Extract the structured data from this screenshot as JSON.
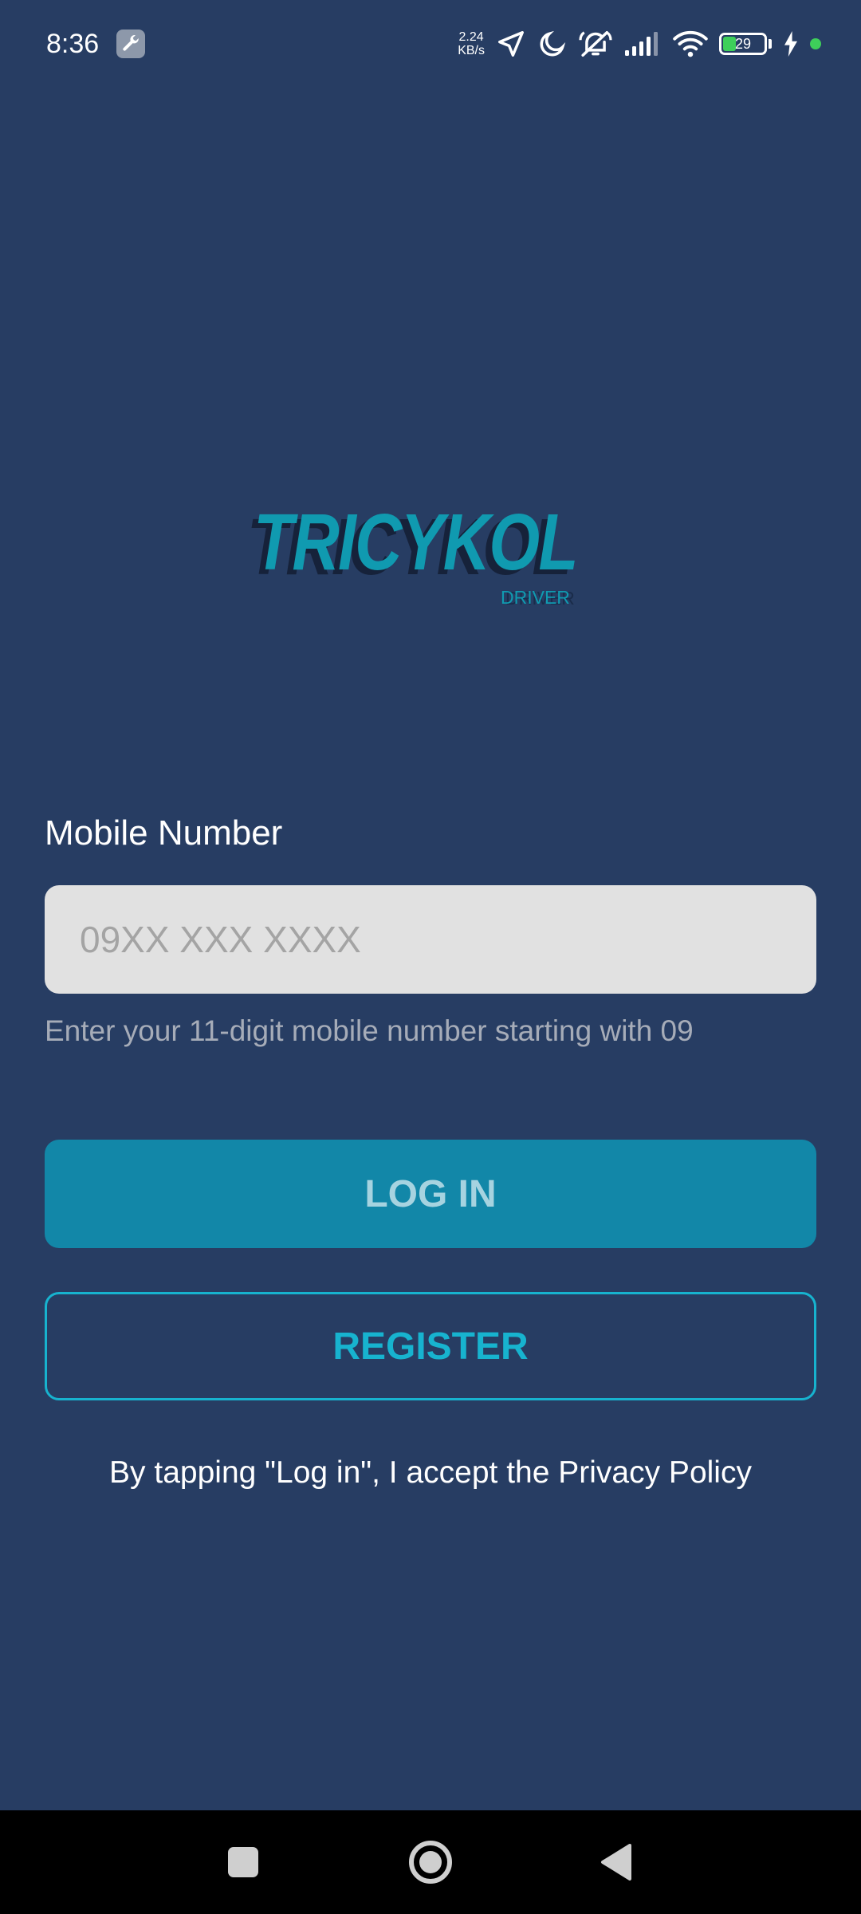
{
  "status_bar": {
    "time": "8:36",
    "net_speed_value": "2.24",
    "net_speed_unit": "KB/s",
    "battery_level": "29",
    "battery_fraction": 0.29,
    "icons": [
      "wrench-icon",
      "location-icon",
      "moon-icon",
      "mute-icon",
      "signal-icon",
      "wifi-icon",
      "battery-icon",
      "charging-icon",
      "active-dot"
    ]
  },
  "logo": {
    "title": "TRICYKOL",
    "subtitle": "DRIVER"
  },
  "form": {
    "mobile_label": "Mobile Number",
    "mobile_placeholder": "09XX XXX XXXX",
    "mobile_value": "",
    "helper": "Enter your 11-digit mobile number starting with 09",
    "login_label": "LOG IN",
    "register_label": "REGISTER",
    "privacy_text": "By tapping \"Log in\", I accept the Privacy Policy"
  },
  "nav_bar": {
    "buttons": [
      "recents-icon",
      "home-icon",
      "back-icon"
    ]
  },
  "colors": {
    "background": "#273d63",
    "accent": "#1287a8",
    "accent_light": "#17b3cf",
    "input_bg": "#e1e1e1"
  }
}
